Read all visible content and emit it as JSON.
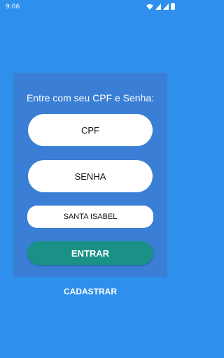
{
  "status_bar": {
    "time": "9:06",
    "icons": [
      "wifi-icon",
      "signal-icon",
      "signal-icon",
      "battery-icon"
    ]
  },
  "login": {
    "prompt": "Entre com seu CPF e Senha:",
    "cpf_label": "CPF",
    "senha_label": "SENHA",
    "location": "SANTA ISABEL",
    "entrar_label": "ENTRAR"
  },
  "cadastrar_label": "CADASTRAR",
  "colors": {
    "background": "#2f8fec",
    "card": "#3a7fd5",
    "entrar_button": "#199187"
  }
}
